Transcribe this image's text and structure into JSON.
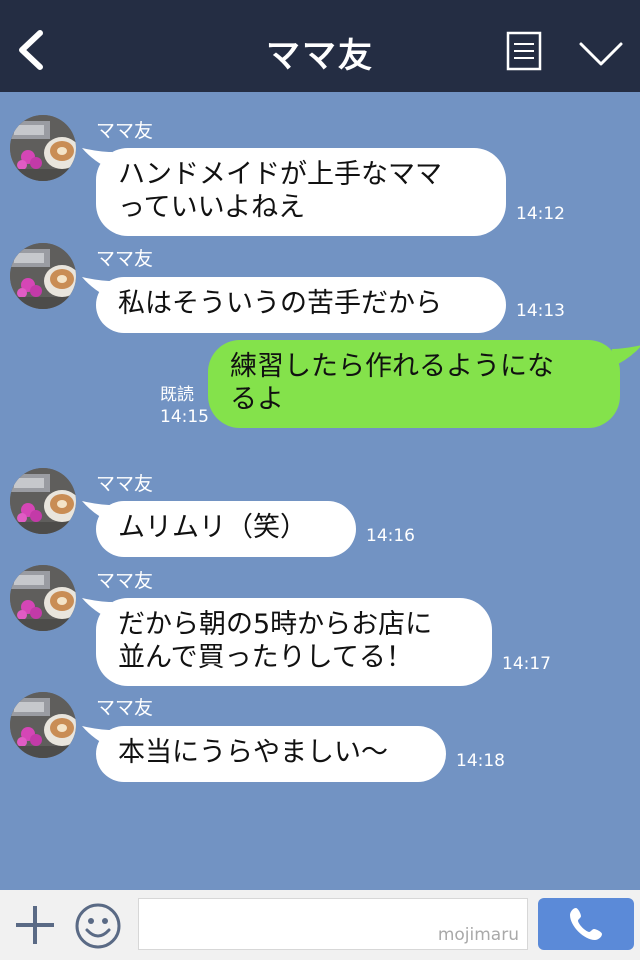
{
  "header": {
    "title": "ママ友"
  },
  "messages": [
    {
      "side": "in",
      "name": "ママ友",
      "text": "ハンドメイドが上手なママ\nっていいよねえ",
      "time": "14:12"
    },
    {
      "side": "in",
      "name": "ママ友",
      "text": "私はそういうの苦手だから",
      "time": "14:13"
    },
    {
      "side": "out",
      "text": "練習したら作れるようにな\nるよ",
      "read": "既読",
      "time": "14:15"
    },
    {
      "side": "in",
      "name": "ママ友",
      "text": "ムリムリ（笑）",
      "time": "14:16"
    },
    {
      "side": "in",
      "name": "ママ友",
      "text": "だから朝の5時からお店に\n並んで買ったりしてる！",
      "time": "14:17"
    },
    {
      "side": "in",
      "name": "ママ友",
      "text": "本当にうらやましい〜",
      "time": "14:18"
    }
  ],
  "footer": {
    "input_value": "",
    "watermark": "mojimaru"
  },
  "colors": {
    "header": "#242d43",
    "background": "#7293c3",
    "outgoing": "#84e24b",
    "incoming": "#ffffff",
    "call": "#5b8ad8"
  },
  "icons": [
    "back-arrow-icon",
    "menu-icon",
    "chevron-down-icon",
    "plus-icon",
    "smiley-icon",
    "phone-icon",
    "avatar-photo"
  ]
}
